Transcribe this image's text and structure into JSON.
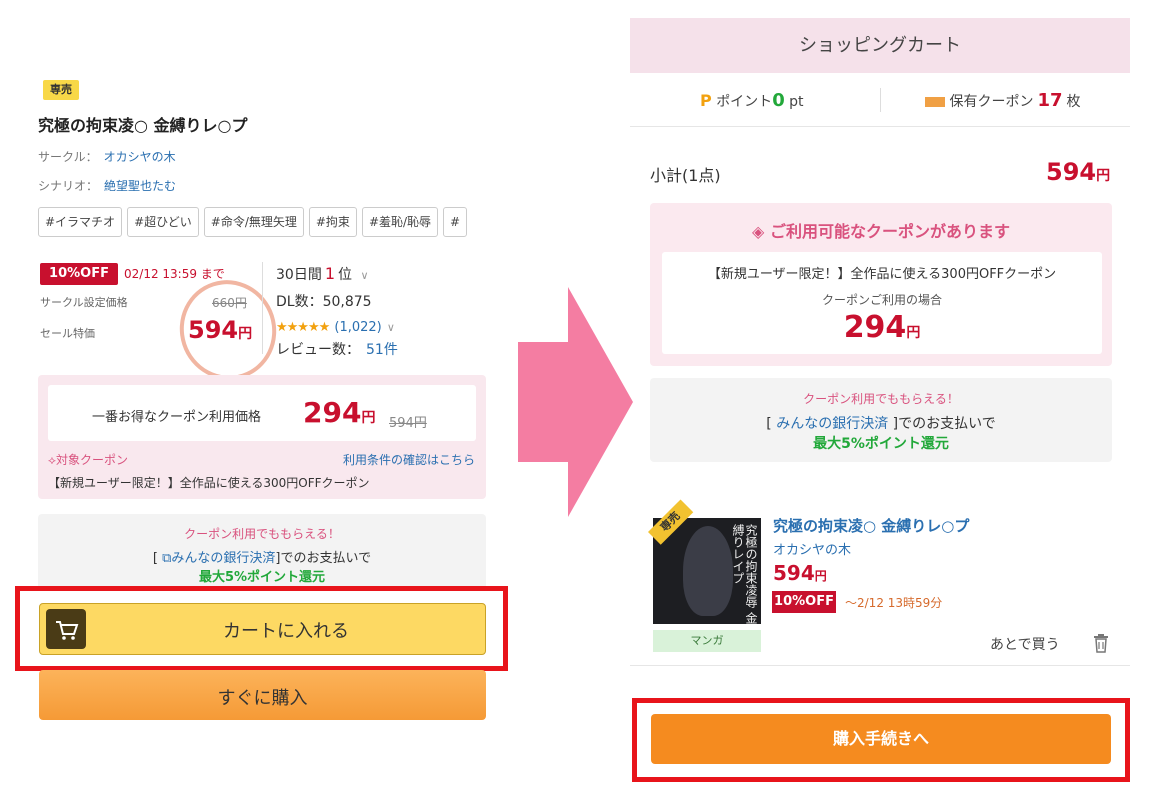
{
  "left": {
    "badge": "専売",
    "title": "究極の拘束凌○ 金縛りレ○プ",
    "circle_label": "サークル：",
    "circle_name": "オカシヤの木",
    "scenario_label": "シナリオ：",
    "scenario_name": "絶望聖也たむ",
    "tags": [
      "#イラマチオ",
      "#超ひどい",
      "#命令/無理矢理",
      "#拘束",
      "#羞恥/恥辱",
      "#"
    ],
    "discount_badge": "10%OFF",
    "deadline": "02/12 13:59 まで",
    "set_price_label": "サークル設定価格",
    "set_price": "660円",
    "sale_label": "セール特価",
    "sale_price": "594",
    "yen": "円",
    "rank_period": "30日間",
    "rank_value": "1",
    "rank_unit": "位",
    "dl_label": "DL数：",
    "dl_count": "50,875",
    "stars": "★★★★★",
    "rating_count": "(1,022)",
    "review_label": "レビュー数：",
    "review_count": "51件",
    "best_coupon_label": "一番お得なクーポン利用価格",
    "best_price": "294",
    "best_orig": "594円",
    "target_coupon": "対象クーポン",
    "terms_link": "利用条件の確認はこちら",
    "coupon_desc": "【新規ユーザー限定！】全作品に使える300円OFFクーポン",
    "bank_header": "クーポン利用でももらえる！",
    "bank_open": "[",
    "bank_link": "みんなの銀行決済",
    "bank_close": "]でのお支払いで",
    "bank_reward": "最大5%ポイント還元",
    "cart_button": "カートに入れる",
    "buy_button": "すぐに購入"
  },
  "right": {
    "header": "ショッピングカート",
    "point_icon": "P",
    "point_label": "ポイント",
    "point_value": "0",
    "point_unit": "pt",
    "coupon_label": "保有クーポン",
    "coupon_count": "17",
    "coupon_unit": "枚",
    "subtotal_label": "小計(1点)",
    "subtotal": "594",
    "yen": "円",
    "avail_title": "ご利用可能なクーポンがあります",
    "avail_desc": "【新規ユーザー限定！】全作品に使える300円OFFクーポン",
    "avail_case": "クーポンご利用の場合",
    "avail_price": "294",
    "bank_header": "クーポン利用でももらえる！",
    "bank_open": "[",
    "bank_link": "みんなの銀行決済",
    "bank_close": "]でのお支払いで",
    "bank_reward": "最大5%ポイント還元",
    "item_badge": "専売",
    "item_title": "究極の拘束凌○ 金縛りレ○プ",
    "item_circle": "オカシヤの木",
    "item_price": "594",
    "item_discount": "10%OFF",
    "item_deadline": "～2/12 13時59分",
    "genre": "マンガ",
    "later": "あとで買う",
    "proceed": "購入手続きへ",
    "thumb_text": "究極の拘束凌辱 金縛りレイプ"
  },
  "colors": {
    "accent_red": "#c8102e",
    "arrow_pink": "#f47da2",
    "frame_red": "#e8141b",
    "cart_yellow": "#fdd963",
    "proceed_orange": "#f58b1f"
  }
}
